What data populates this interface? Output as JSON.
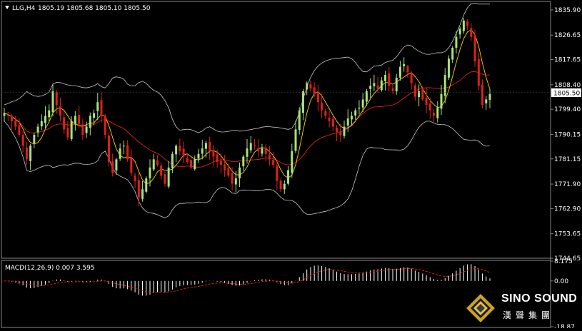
{
  "header": {
    "symbol": "LLG,H4",
    "ohlc": "1805.19 1805.68 1805.10 1805.50"
  },
  "price_axis": {
    "ticks": [
      "1835.90",
      "1826.65",
      "1817.65",
      "1808.40",
      "1799.40",
      "1790.15",
      "1781.15",
      "1771.90",
      "1762.90",
      "1753.65",
      "1744.65"
    ],
    "current_price": "1805.50",
    "current_value": 1805.5
  },
  "macd_panel": {
    "label": "MACD(12,26,9) 0.007 3.595",
    "ticks": [
      "8.175",
      "0.00",
      "-18.87"
    ]
  },
  "brand": {
    "name": "SINO SOUND",
    "subtitle": "漢聲集團"
  },
  "colors": {
    "bull": "#a8e27a",
    "bear": "#e0201b",
    "bands": "#c8c8c8",
    "ma": "#ffd700",
    "macd_hist": "#ffffff",
    "macd_signal": "#e0201b"
  },
  "chart_data": {
    "type": "candlestick",
    "y_range": [
      1744.65,
      1838.5
    ],
    "series_closes": [
      1798,
      1797,
      1795,
      1793,
      1790,
      1786,
      1781,
      1786,
      1790,
      1793,
      1795,
      1797,
      1799,
      1806,
      1801,
      1797,
      1792,
      1789,
      1795,
      1797,
      1794,
      1790,
      1793,
      1797,
      1798,
      1802,
      1797,
      1790,
      1780,
      1776,
      1781,
      1785,
      1786,
      1781,
      1776,
      1773,
      1767,
      1770,
      1774,
      1778,
      1781,
      1779,
      1775,
      1772,
      1778,
      1783,
      1786,
      1784,
      1782,
      1780,
      1778,
      1781,
      1783,
      1785,
      1787,
      1784,
      1782,
      1780,
      1779,
      1777,
      1775,
      1772,
      1774,
      1778,
      1782,
      1785,
      1787,
      1786,
      1784,
      1785,
      1783,
      1781,
      1779,
      1773,
      1770,
      1772,
      1777,
      1784,
      1792,
      1799,
      1806,
      1809,
      1807,
      1805,
      1802,
      1799,
      1797,
      1795,
      1793,
      1791,
      1790,
      1793,
      1796,
      1797,
      1799,
      1800,
      1803,
      1806,
      1808,
      1809,
      1807,
      1810,
      1812,
      1808,
      1806,
      1811,
      1815,
      1816,
      1813,
      1809,
      1804,
      1806,
      1803,
      1801,
      1799,
      1797,
      1800,
      1805,
      1812,
      1818,
      1822,
      1826,
      1829,
      1832,
      1830,
      1826,
      1817,
      1808,
      1801,
      1803,
      1805
    ],
    "ylabel": ""
  }
}
